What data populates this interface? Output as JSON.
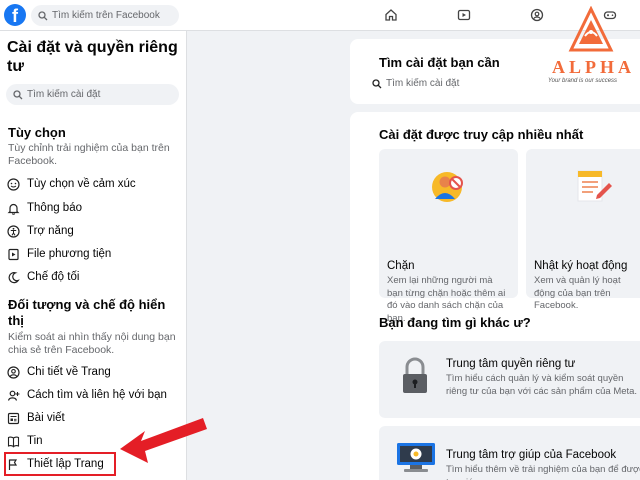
{
  "topbar": {
    "logo_letter": "f",
    "search_placeholder": "Tìm kiếm trên Facebook"
  },
  "sidebar": {
    "title": "Cài đặt và quyền riêng tư",
    "search_placeholder": "Tìm kiếm cài đặt",
    "sections": [
      {
        "title": "Tùy chọn",
        "desc": "Tùy chỉnh trải nghiệm của bạn trên Facebook.",
        "items": [
          {
            "label": "Tùy chọn về cảm xúc",
            "icon": "reaction-icon"
          },
          {
            "label": "Thông báo",
            "icon": "bell-icon"
          },
          {
            "label": "Trợ năng",
            "icon": "accessibility-icon"
          },
          {
            "label": "File phương tiện",
            "icon": "media-file-icon"
          },
          {
            "label": "Chế độ tối",
            "icon": "moon-icon"
          }
        ]
      },
      {
        "title": "Đối tượng và chế độ hiển thị",
        "desc": "Kiểm soát ai nhìn thấy nội dung bạn chia sẻ trên Facebook.",
        "items": [
          {
            "label": "Chi tiết về Trang",
            "icon": "person-icon"
          },
          {
            "label": "Cách tìm và liên hệ với bạn",
            "icon": "person-add-icon"
          },
          {
            "label": "Bài viết",
            "icon": "post-icon"
          },
          {
            "label": "Tin",
            "icon": "book-icon"
          },
          {
            "label": "Thiết lập Trang",
            "icon": "flag-icon"
          }
        ]
      }
    ]
  },
  "main": {
    "search_card": {
      "title": "Tìm cài đặt bạn cần",
      "placeholder": "Tìm kiếm cài đặt"
    },
    "frequent": {
      "title": "Cài đặt được truy cập nhiều nhất",
      "tiles": [
        {
          "title": "Chặn",
          "desc": "Xem lại những người mà bạn từng chặn hoặc thêm ai đó vào danh sách chặn của bạn."
        },
        {
          "title": "Nhật ký hoạt động",
          "desc": "Xem và quản lý hoạt động của bạn trên Facebook."
        }
      ]
    },
    "other": {
      "title": "Bạn đang tìm gì khác ư?",
      "rows": [
        {
          "title": "Trung tâm quyền riêng tư",
          "desc": "Tìm hiểu cách quản lý và kiểm soát quyền riêng tư của bạn với các sản phẩm của Meta."
        },
        {
          "title": "Trung tâm trợ giúp của Facebook",
          "desc": "Tìm hiểu thêm về trải nghiệm của bạn để được trợ giúp."
        }
      ]
    }
  },
  "watermark": {
    "word": "ALPHA",
    "slogan": "Your brand is our success"
  },
  "colors": {
    "facebook_blue": "#1877f2",
    "highlight_red": "#e41e26",
    "alpha_orange": "#f26b3a"
  }
}
